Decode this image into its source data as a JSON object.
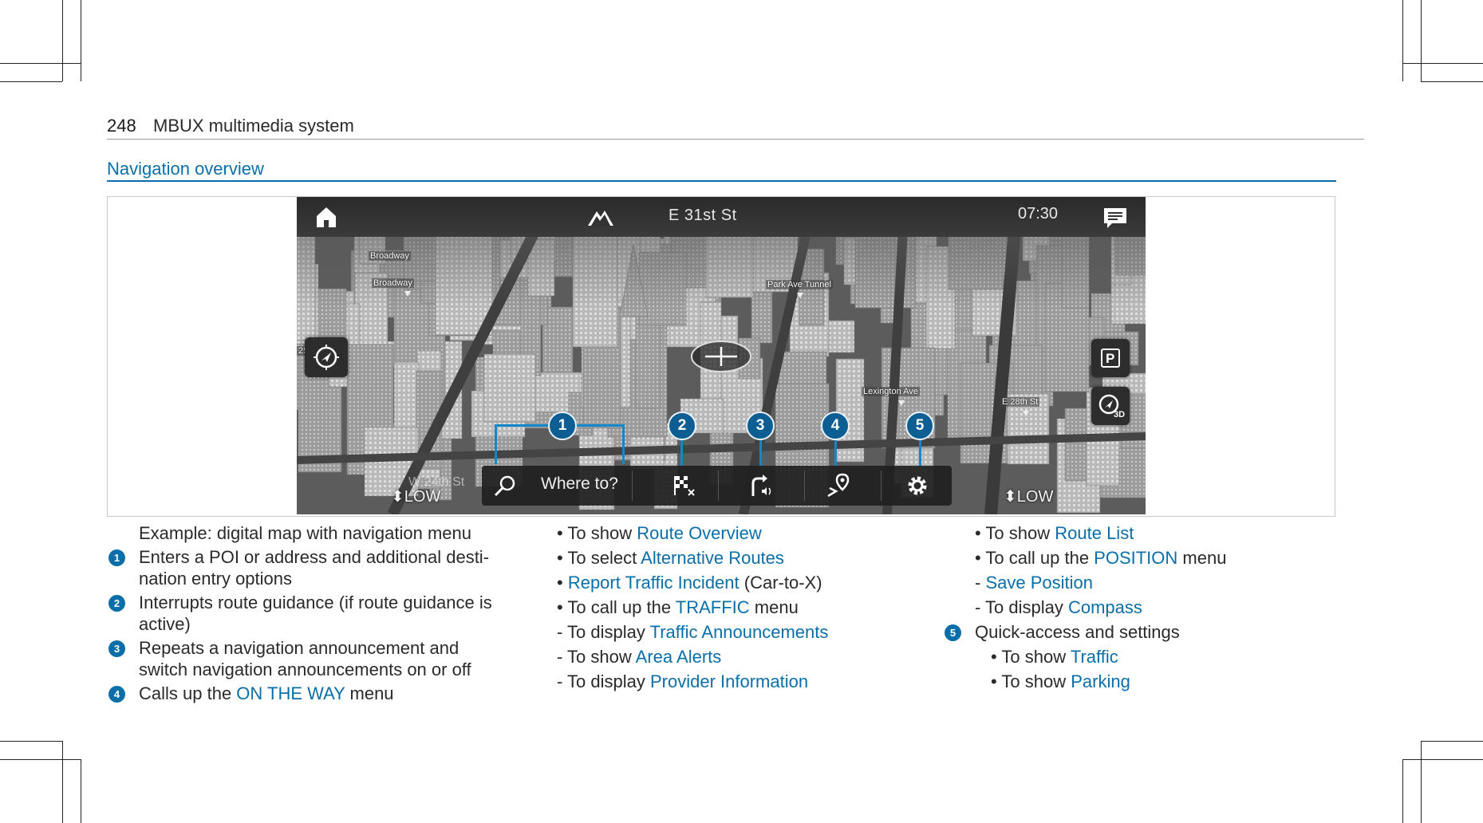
{
  "header": {
    "page_number": "248",
    "title": "MBUX multimedia system"
  },
  "section_title": "Navigation overview",
  "screen": {
    "street": "E 31st St",
    "clock": "07:30",
    "search_placeholder": "Where to?",
    "low_left": "⬍LOW",
    "low_right": "⬍LOW",
    "street_bottom": "W 24th St",
    "map_labels": [
      "Broadway",
      "Broadway",
      "Park Ave Tunnel",
      "Lexington Ave",
      "E 28th St"
    ],
    "map_left_digit": "25",
    "parking_letter": "P",
    "view_3d": "3D",
    "callouts": [
      "1",
      "2",
      "3",
      "4",
      "5"
    ],
    "icons": [
      "home-icon",
      "mountain-icon",
      "message-icon",
      "compass-icon",
      "parking-icon",
      "3d-view-icon",
      "search-icon",
      "destination-flag-icon",
      "voice-announcement-icon",
      "on-the-way-icon",
      "settings-gear-icon"
    ]
  },
  "col1": {
    "caption": "Example: digital map with navigation menu",
    "items": [
      {
        "badge": "1",
        "lines": [
          "Enters a POI or address and additional desti-",
          "nation entry options"
        ]
      },
      {
        "badge": "2",
        "lines": [
          "Interrupts route guidance (if route guidance is",
          "active)"
        ]
      },
      {
        "badge": "3",
        "lines": [
          "Repeats a navigation announcement and",
          "switch navigation announcements on or off"
        ]
      },
      {
        "badge": "4",
        "pre": "Calls up the ",
        "link": "ON THE WAY",
        "post": " menu"
      }
    ]
  },
  "col2": {
    "lines": [
      {
        "prefix": "• To show ",
        "link": "Route Overview",
        "post": ""
      },
      {
        "prefix": "• To select ",
        "link": "Alternative Routes",
        "post": ""
      },
      {
        "prefix": "• ",
        "link": "Report Traffic Incident",
        "post": " (Car-to-X)"
      },
      {
        "prefix": "• To call up the ",
        "link": "TRAFFIC",
        "post": " menu"
      },
      {
        "prefix": "- To display ",
        "link": "Traffic Announcements",
        "post": ""
      },
      {
        "prefix": "- To show ",
        "link": "Area Alerts",
        "post": ""
      },
      {
        "prefix": "- To display ",
        "link": "Provider Information",
        "post": ""
      }
    ]
  },
  "col3": {
    "lines": [
      {
        "prefix": "• To show ",
        "link": "Route List",
        "post": ""
      },
      {
        "prefix": "• To call up the ",
        "link": "POSITION",
        "post": " menu"
      },
      {
        "prefix": "- ",
        "link": "Save Position",
        "post": ""
      },
      {
        "prefix": "- To display ",
        "link": "Compass",
        "post": ""
      }
    ],
    "item5": {
      "badge": "5",
      "text": "Quick-access and settings"
    },
    "sub": [
      {
        "prefix": "• To show ",
        "link": "Traffic"
      },
      {
        "prefix": "• To show ",
        "link": "Parking"
      }
    ]
  },
  "colors": {
    "accent": "#0a6fa8",
    "callout": "#0d5f93"
  }
}
